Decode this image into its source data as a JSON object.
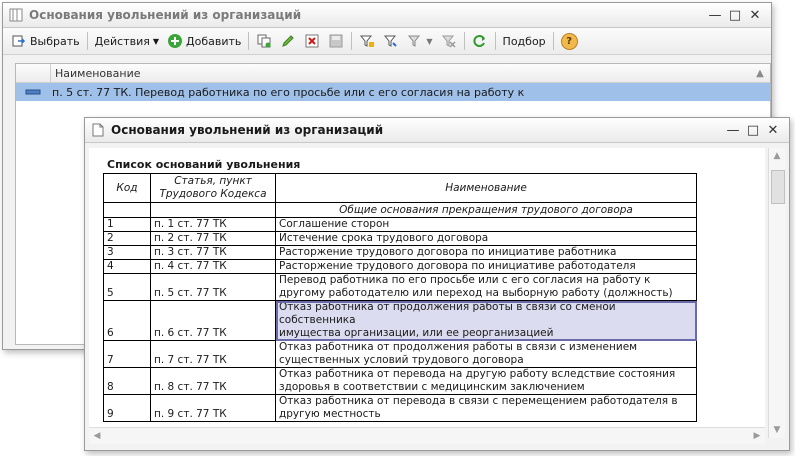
{
  "back_window": {
    "title": "Основания увольнений из организаций",
    "toolbar": {
      "select_label": "Выбрать",
      "actions_label": "Действия",
      "add_label": "Добавить",
      "selection_label": "Подбор",
      "help_label": "?"
    },
    "list": {
      "column_header": "Наименование",
      "rows": [
        {
          "name": "п. 5 ст. 77 ТК. Перевод  работника по его просьбе или с его согласия на работу к"
        }
      ]
    }
  },
  "front_window": {
    "title": "Основания увольнений из организаций",
    "report": {
      "title": "Список оснований увольнения",
      "headers": {
        "code": "Код",
        "article_line1": "Статья, пункт",
        "article_line2": "Трудового Кодекса",
        "name": "Наименование"
      },
      "section": "Общие основания прекращения трудового договора",
      "rows": [
        {
          "code": "1",
          "article": "п. 1 ст. 77 ТК",
          "line1": "Соглашение сторон",
          "line2": ""
        },
        {
          "code": "2",
          "article": "п. 2 ст. 77 ТК",
          "line1": "Истечение срока трудового договора",
          "line2": ""
        },
        {
          "code": "3",
          "article": "п. 3 ст. 77 ТК",
          "line1": "Расторжение трудового договора по инициативе работника",
          "line2": ""
        },
        {
          "code": "4",
          "article": "п. 4 ст. 77 ТК",
          "line1": "Расторжение трудового договора по инициативе работодателя",
          "line2": ""
        },
        {
          "code": "5",
          "article": "п. 5 ст. 77 ТК",
          "line1": "Перевод  работника по его просьбе или с его согласия на работу к",
          "line2": "другому работодателю или переход на выборную работу (должность)"
        },
        {
          "code": "6",
          "article": "п. 6 ст. 77 ТК",
          "line1": "Отказ работника от продолжения работы в связи со сменой собственника",
          "line2": "имущества организации, или ее реорганизацией"
        },
        {
          "code": "7",
          "article": "п. 7 ст. 77 ТК",
          "line1": "Отказ  работника  от  продолжения  работы  в  связи  с изменением",
          "line2": "существенных условий трудового договора"
        },
        {
          "code": "8",
          "article": "п. 8 ст. 77 ТК",
          "line1": "Отказ работника от перевода на другую работу вследствие состояния",
          "line2": "здоровья  в  соответствии  с медицинским заключением"
        },
        {
          "code": "9",
          "article": "п. 9 ст. 77 ТК",
          "line1": "Отказ работника от перевода в связи с перемещением работодателя в",
          "line2": "другую местность"
        }
      ]
    }
  },
  "colors": {
    "selected_row": "#9fc0e8",
    "highlight_cell": "#dcdcf0"
  }
}
